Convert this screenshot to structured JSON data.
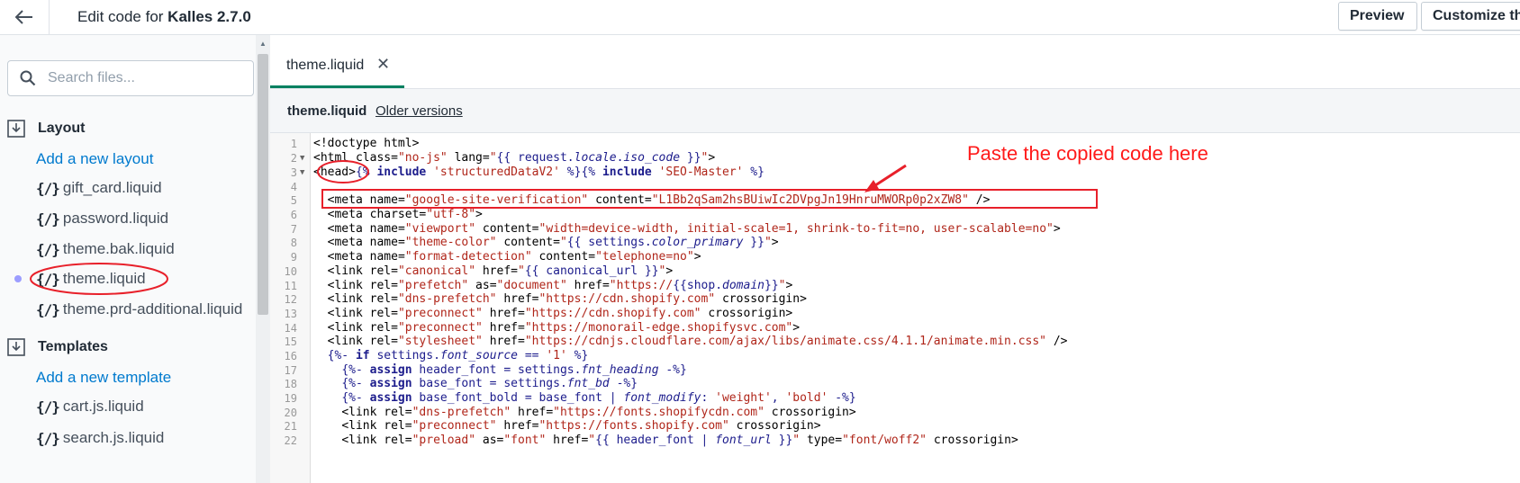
{
  "header": {
    "title_prefix": "Edit code for ",
    "theme_name": "Kalles 2.7.0",
    "preview_label": "Preview",
    "customize_label": "Customize th"
  },
  "sidebar": {
    "search_placeholder": "Search files...",
    "layout": {
      "label": "Layout",
      "add_label": "Add a new layout",
      "files": [
        "gift_card.liquid",
        "password.liquid",
        "theme.bak.liquid",
        "theme.liquid",
        "theme.prd-additional.liquid"
      ],
      "active_file": "theme.liquid"
    },
    "templates": {
      "label": "Templates",
      "add_label": "Add a new template",
      "files": [
        "cart.js.liquid",
        "search.js.liquid"
      ]
    },
    "icon": "{/}"
  },
  "editor": {
    "tab_label": "theme.liquid",
    "tab_close": "✕",
    "file_name": "theme.liquid",
    "older_versions": "Older versions",
    "line_numbers": [
      "1",
      "2",
      "3",
      "4",
      "5",
      "6",
      "7",
      "8",
      "9",
      "10",
      "11",
      "12",
      "13",
      "14",
      "15",
      "16",
      "17",
      "18",
      "19",
      "20",
      "21",
      "22"
    ]
  },
  "annotation": {
    "text": "Paste the copied code here",
    "color": "#ff1a1a"
  }
}
